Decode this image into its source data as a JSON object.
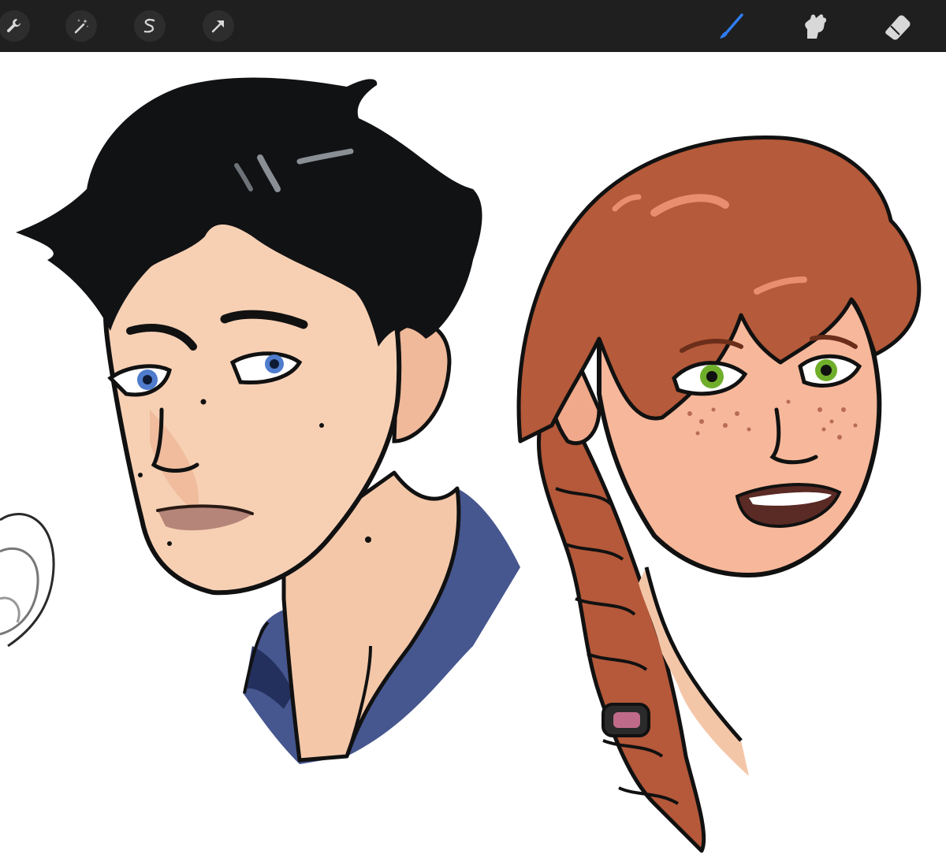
{
  "app": {
    "accent_color": "#2f7df6",
    "toolbar_color": "#1f1f1f"
  },
  "toolbar": {
    "left_tools": [
      {
        "name": "actions",
        "icon": "wrench-icon"
      },
      {
        "name": "adjustments",
        "icon": "magic-wand-icon"
      },
      {
        "name": "selection",
        "icon": "selection-s-icon"
      },
      {
        "name": "transform",
        "icon": "arrow-cursor-icon"
      }
    ],
    "right_tools": [
      {
        "name": "brush",
        "icon": "brush-icon",
        "active": true
      },
      {
        "name": "smudge",
        "icon": "smudge-hand-icon",
        "active": false
      },
      {
        "name": "eraser",
        "icon": "eraser-icon",
        "active": false
      }
    ]
  },
  "canvas": {
    "artwork": "two-portrait-sketches"
  }
}
